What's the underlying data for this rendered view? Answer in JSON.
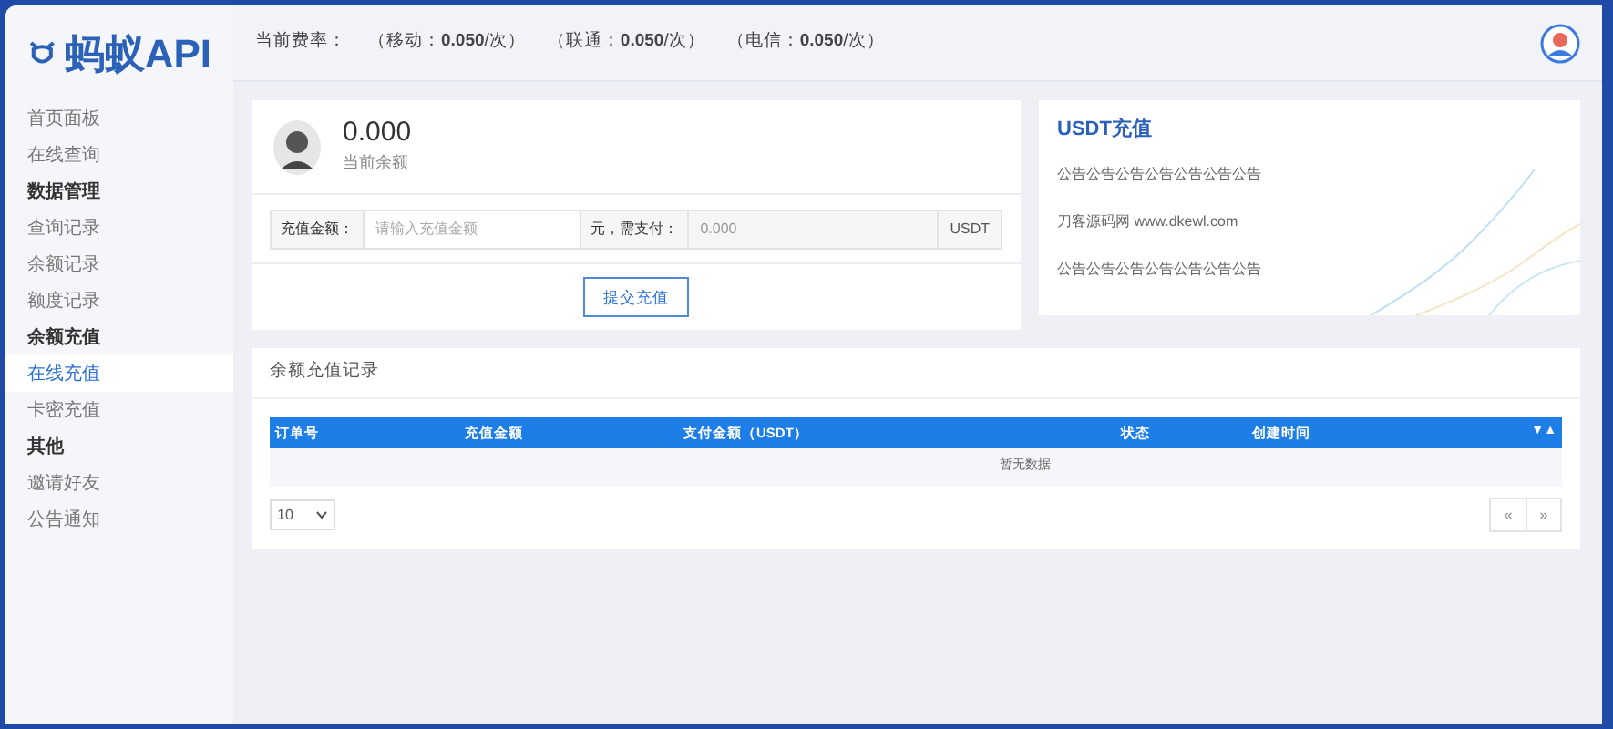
{
  "logo": {
    "text": "蚂蚁API"
  },
  "header": {
    "label": "当前费率：",
    "rates": [
      "（移动：**0.050**/次）",
      "（联通：**0.050**/次）",
      "（电信：**0.050**/次）"
    ]
  },
  "sidebar": {
    "items": [
      {
        "kind": "item",
        "label": "首页面板",
        "selected": false
      },
      {
        "kind": "item",
        "label": "在线查询",
        "selected": false
      },
      {
        "kind": "group",
        "label": "数据管理"
      },
      {
        "kind": "item",
        "label": "查询记录",
        "selected": false
      },
      {
        "kind": "item",
        "label": "余额记录",
        "selected": false
      },
      {
        "kind": "item",
        "label": "额度记录",
        "selected": false
      },
      {
        "kind": "group",
        "label": "余额充值"
      },
      {
        "kind": "item",
        "label": "在线充值",
        "selected": true
      },
      {
        "kind": "item",
        "label": "卡密充值",
        "selected": false
      },
      {
        "kind": "group",
        "label": "其他"
      },
      {
        "kind": "item",
        "label": "邀请好友",
        "selected": false
      },
      {
        "kind": "item",
        "label": "公告通知",
        "selected": false
      }
    ]
  },
  "balance": {
    "amount": "0.000",
    "label": "当前余额"
  },
  "recharge_form": {
    "amount_label": "充值金额：",
    "amount_placeholder": "请输入充值金额",
    "pay_label": "元，需支付：",
    "pay_value": "0.000",
    "unit": "USDT",
    "submit": "提交充值"
  },
  "notice": {
    "title": "USDT充值",
    "lines": [
      "公告公告公告公告公告公告公告",
      "刀客源码网 www.dkewl.com",
      "公告公告公告公告公告公告公告"
    ]
  },
  "records": {
    "title": "余额充值记录",
    "columns": [
      "订单号",
      "充值金额",
      "支付金额（USDT）",
      "状态",
      "创建时间"
    ],
    "sort_glyph": "▼▲",
    "empty": "暂无数据",
    "page_size": "10",
    "pager": [
      "«",
      "»"
    ]
  }
}
